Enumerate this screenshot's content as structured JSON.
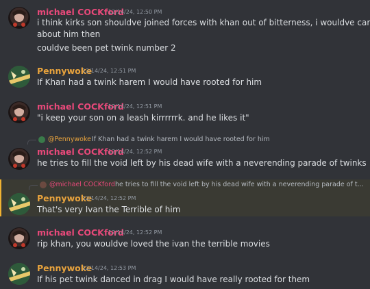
{
  "messages": [
    {
      "author": "michael COCKford",
      "timestamp": "12/14/24, 12:50 PM",
      "lines": [
        "i think kirks son shouldve joined forces with khan out of bitterness, i wouldve cared",
        "about him then",
        "couldve been pet twink number 2"
      ]
    },
    {
      "author": "Pennywoke",
      "timestamp": "12/14/24, 12:51 PM",
      "lines": [
        "If Khan had a twink harem I would have rooted for him"
      ]
    },
    {
      "author": "michael COCKford",
      "timestamp": "12/14/24, 12:51 PM",
      "lines": [
        "\"i keep your son on a leash kirrrrrrk. and he likes it\""
      ]
    },
    {
      "reply_to": {
        "author": "@Pennywoke",
        "text": "If Khan had a twink harem I would have rooted for him"
      },
      "author": "michael COCKford",
      "timestamp": "12/14/24, 12:52 PM",
      "lines": [
        "he tries to fill the void left by his dead wife with a neverending parade of twinks"
      ]
    },
    {
      "reply_to": {
        "author": "@michael COCKford",
        "text": "he tries to fill the void left by his dead wife with a neverending parade of t..."
      },
      "author": "Pennywoke",
      "timestamp": "12/14/24, 12:52 PM",
      "lines": [
        "That's very Ivan the Terrible of him"
      ]
    },
    {
      "author": "michael COCKford",
      "timestamp": "12/14/24, 12:52 PM",
      "lines": [
        "rip khan, you wouldve loved the ivan the terrible movies"
      ]
    },
    {
      "author": "Pennywoke",
      "timestamp": "12/14/24, 12:53 PM",
      "lines": [
        "If his pet twink danced in drag I would have really rooted for them"
      ]
    }
  ],
  "colors": {
    "background": "#313338",
    "highlight": "#3a3a33",
    "michael_name": "#e8497a",
    "pennywoke_name": "#e8a33d"
  }
}
